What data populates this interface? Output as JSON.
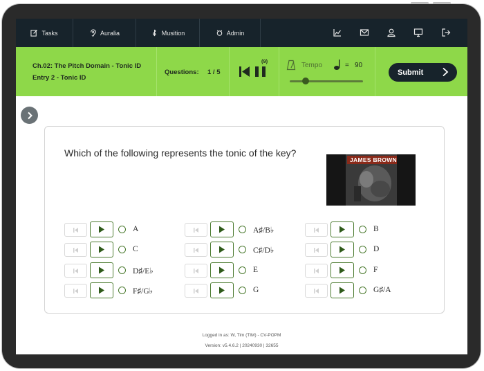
{
  "nav": {
    "items": [
      {
        "label": "Tasks",
        "icon": "edit-icon"
      },
      {
        "label": "Auralia",
        "icon": "ear-icon"
      },
      {
        "label": "Musition",
        "icon": "treble-clef-icon"
      },
      {
        "label": "Admin",
        "icon": "admin-icon"
      }
    ],
    "right_icons": [
      "chart-icon",
      "mail-icon",
      "user-icon",
      "monitor-icon",
      "logout-icon"
    ]
  },
  "task": {
    "title_line1": "Ch.02: The Pitch Domain - Tonic ID",
    "title_line2": "Entry 2 - Tonic ID",
    "questions_label": "Questions:",
    "questions_count": "1 / 5",
    "play_count": "(9)",
    "tempo_label": "Tempo",
    "tempo_eq": "=",
    "tempo_value": "90",
    "submit_label": "Submit"
  },
  "question": {
    "text": "Which of the following represents the tonic of the key?",
    "album_text": "JAMES BROWN"
  },
  "answers": [
    "A",
    "A♯/B♭",
    "B",
    "C",
    "C♯/D♭",
    "D",
    "D♯/E♭",
    "E",
    "F",
    "F♯/G♭",
    "G",
    "G♯/A"
  ],
  "footer": {
    "logged_in": "Logged in as: W, Tim (TIM) - CV-POPM",
    "version": "Version: v5.4.6.2 | 20240930 | 32655"
  },
  "colors": {
    "accent_green": "#8ed849",
    "nav_dark": "#17232b",
    "control_green": "#4a7a2e"
  }
}
